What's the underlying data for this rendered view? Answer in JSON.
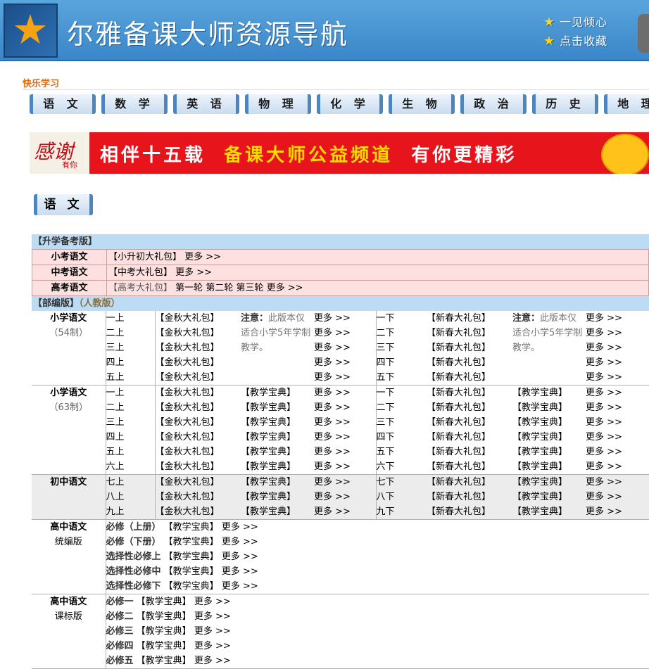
{
  "header": {
    "title": "尔雅备课大师资源导航",
    "link1": "一见倾心",
    "link2": "点击收藏"
  },
  "section_label": "快乐学习",
  "subjects": [
    "语 文",
    "数 学",
    "英 语",
    "物 理",
    "化 学",
    "生 物",
    "政 治",
    "历 史",
    "地 理"
  ],
  "banner": {
    "badge": "感谢",
    "badge_small": "有你",
    "part1": "相伴十五载",
    "part2": "备课大师公益频道",
    "part3": "有你更精彩"
  },
  "subject_header": "语 文",
  "sections": {
    "exam_title": "【升学备考版】",
    "bubian_title": "【部编版】",
    "bubian_paren": "（人教版）"
  },
  "exam_rows": [
    {
      "label": "小考语文",
      "items": [
        "【小升初大礼包】",
        "更多 >>"
      ]
    },
    {
      "label": "中考语文",
      "items": [
        "【中考大礼包】",
        "更多 >>"
      ]
    },
    {
      "label": "高考语文",
      "items": [
        "【高考大礼包】",
        "第一轮",
        "第二轮",
        "第三轮",
        "更多 >>"
      ]
    }
  ],
  "common": {
    "jinqiu": "【金秋大礼包】",
    "xinchun": "【新春大礼包】",
    "baodian": "【教学宝典】",
    "more": "更多 >>",
    "note_label": "注意：",
    "note_text": "此版本仅适合小学5年学制教学。"
  },
  "primary54": {
    "label": "小学语文",
    "sub": "（54制）",
    "up": [
      "一上",
      "二上",
      "三上",
      "四上",
      "五上"
    ],
    "down": [
      "一下",
      "二下",
      "三下",
      "四下",
      "五下"
    ]
  },
  "primary63": {
    "label": "小学语文",
    "sub": "（63制）",
    "up": [
      "一上",
      "二上",
      "三上",
      "四上",
      "五上",
      "六上"
    ],
    "down": [
      "一下",
      "二下",
      "三下",
      "四下",
      "五下",
      "六下"
    ]
  },
  "junior": {
    "label": "初中语文",
    "up": [
      "七上",
      "八上",
      "九上"
    ],
    "down": [
      "七下",
      "八下",
      "九下"
    ]
  },
  "senior_unified": {
    "label": "高中语文",
    "sub": "统编版",
    "rows": [
      "必修（上册）",
      "必修（下册）",
      "选择性必修上",
      "选择性必修中",
      "选择性必修下"
    ]
  },
  "senior_standard": {
    "label": "高中语文",
    "sub": "课标版",
    "rows": [
      "必修一",
      "必修二",
      "必修三",
      "必修四",
      "必修五"
    ]
  }
}
